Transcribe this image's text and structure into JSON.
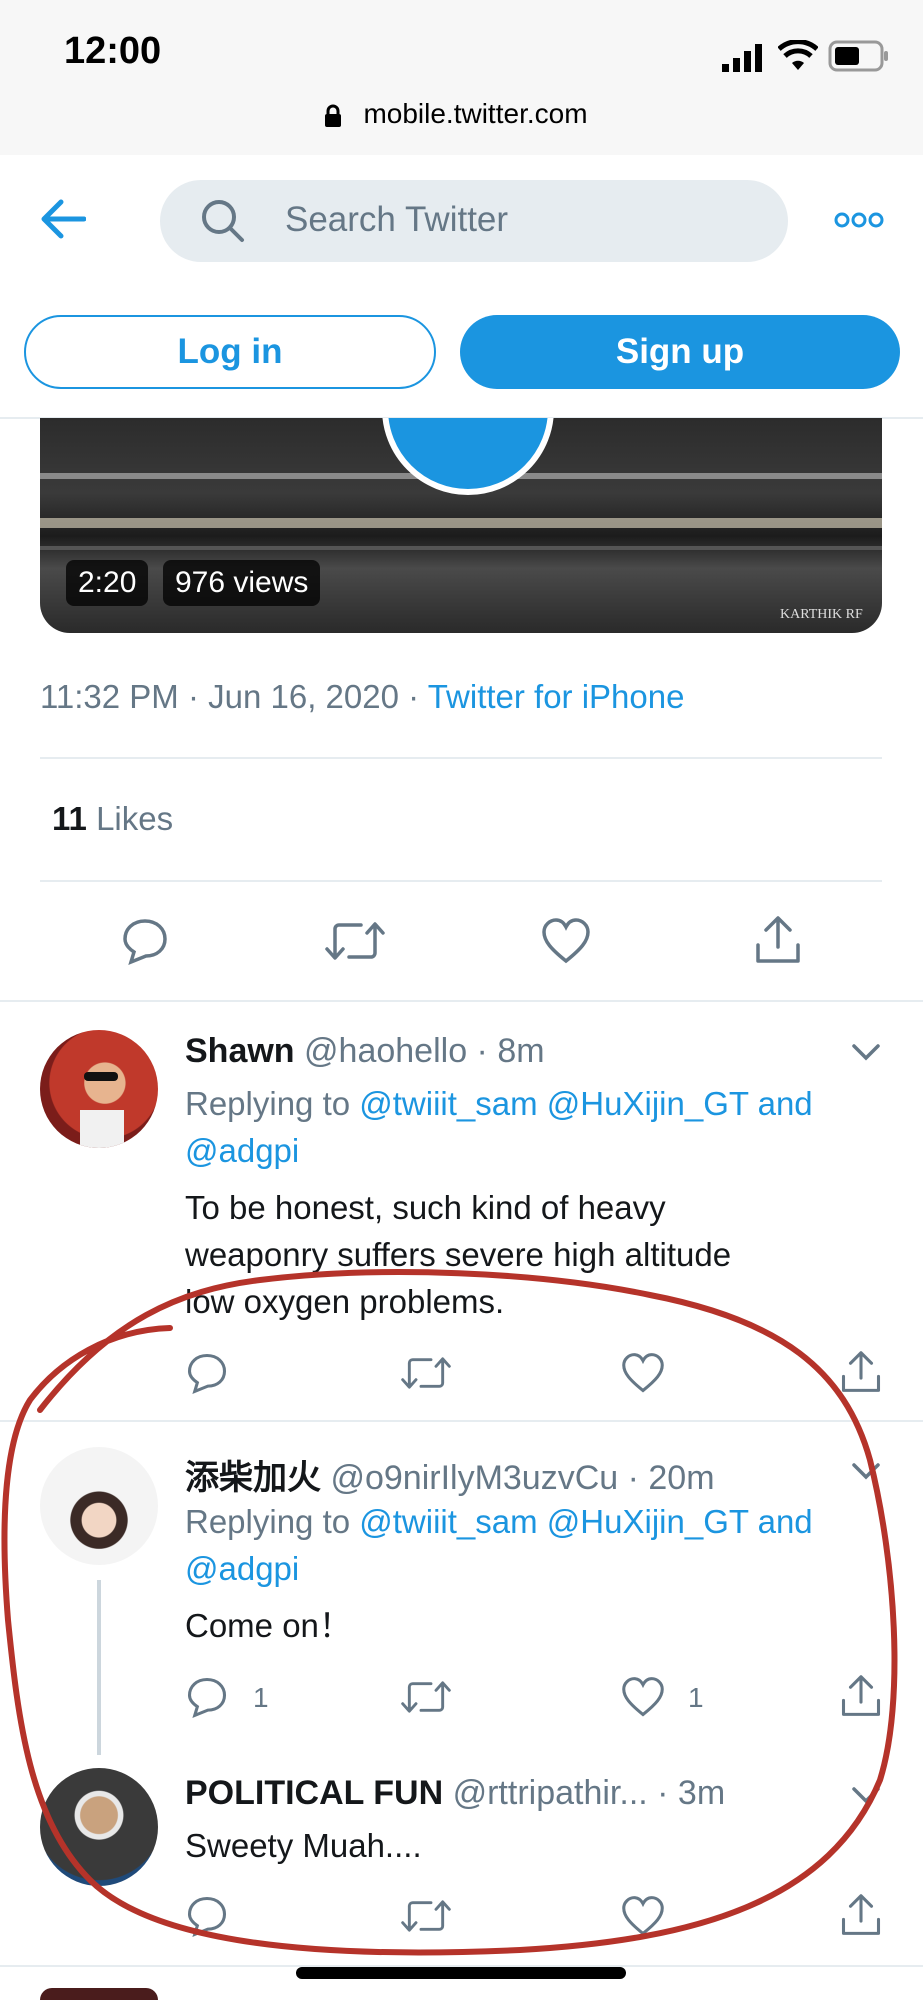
{
  "status": {
    "time": "12:00",
    "url": "mobile.twitter.com"
  },
  "header": {
    "search_placeholder": "Search Twitter",
    "login": "Log in",
    "signup": "Sign up"
  },
  "video": {
    "duration": "2:20",
    "views": "976 views",
    "watermark": "KARTHIK RF"
  },
  "tweet": {
    "time": "11:32 PM · Jun 16, 2020 · ",
    "source": "Twitter for iPhone",
    "likes_count": "11",
    "likes_label": "Likes"
  },
  "replies": [
    {
      "name": "Shawn",
      "handle": "@haohello · 8m",
      "replying_prefix": "Replying to ",
      "replying_targets": "@twiiit_sam @HuXijin_GT and",
      "replying_line2": "@adgpi",
      "text1": "To be honest, such kind of heavy",
      "text2": "weaponry suffers severe high altitude",
      "text3": "low oxygen problems."
    },
    {
      "name": "添柴加火",
      "handle": "@o9nirIlyM3uzvCu · 20m",
      "replying_prefix": "Replying to ",
      "replying_targets": "@twiiit_sam @HuXijin_GT and",
      "replying_line2": "@adgpi",
      "text1": "Come on！",
      "reply_count": "1",
      "like_count": "1"
    },
    {
      "name": "POLITICAL FUN",
      "handle": "@rttripathir...  · 3m",
      "text1": "Sweety Muah...."
    }
  ],
  "colors": {
    "accent": "#1b95e0",
    "annotation": "#b5332a"
  }
}
